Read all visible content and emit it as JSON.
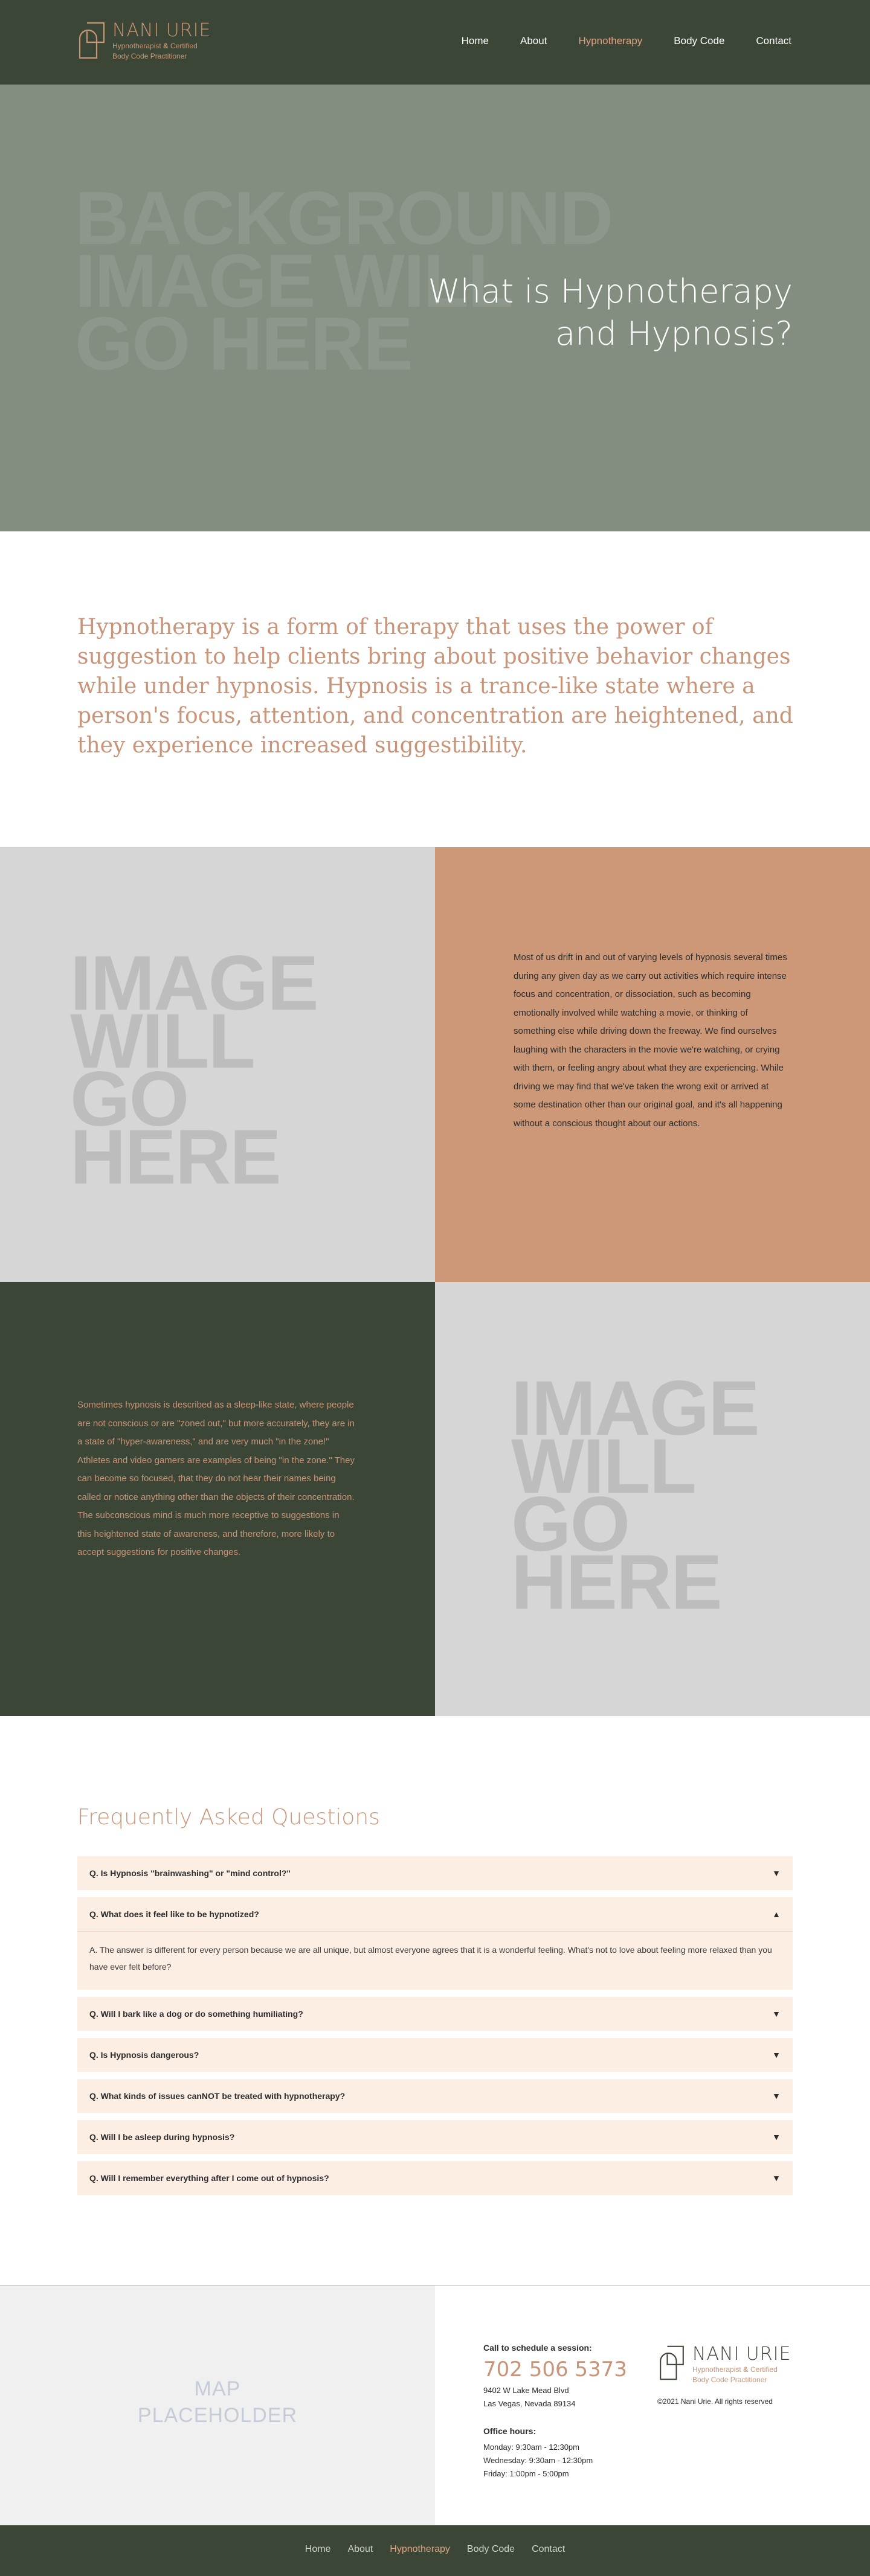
{
  "brand": {
    "name": "NANI URIE",
    "subtitle_line1_pre": "Hypnotherapist ",
    "subtitle_amp": "&",
    "subtitle_line1_post": " Certified",
    "subtitle_line2": "Body Code Practitioner"
  },
  "nav": {
    "items": [
      {
        "label": "Home",
        "active": false
      },
      {
        "label": "About",
        "active": false
      },
      {
        "label": "Hypnotherapy",
        "active": true
      },
      {
        "label": "Body Code",
        "active": false
      },
      {
        "label": "Contact",
        "active": false
      }
    ]
  },
  "hero": {
    "placeholder_lines": [
      "BACKGROUND",
      "IMAGE WILL",
      "GO HERE"
    ],
    "title_line1": "What is Hypnotherapy",
    "title_line2": "and Hypnosis?"
  },
  "intro": {
    "text": "Hypnotherapy is a form of therapy that uses the power of suggestion to help clients bring about positive behavior changes while under hypnosis. Hypnosis is a trance-like state where a person's focus, attention, and concentration are heightened, and they experience increased suggestibility."
  },
  "section1": {
    "placeholder_lines": [
      "IMAGE",
      "WILL",
      "GO",
      "HERE"
    ],
    "text": "Most of us drift in and out of varying levels of hypnosis several times during any given day as we carry out activities which require intense focus and concentration, or dissociation, such as becoming emotionally involved while watching a movie, or thinking of something else while driving down the freeway. We find ourselves laughing with the characters in the movie we're watching, or crying with them, or feeling angry about what they are experiencing. While driving we may find that we've taken the wrong exit or arrived at some destination other than our original goal, and it's all happening without a conscious thought about our actions."
  },
  "section2": {
    "placeholder_lines": [
      "IMAGE",
      "WILL",
      "GO",
      "HERE"
    ],
    "text": "Sometimes hypnosis is described as a sleep-like state, where people are not conscious or are \"zoned out,\" but more accurately, they are in a state of \"hyper-awareness,\" and are very much \"in the zone!\"  Athletes and video gamers are examples of being \"in the zone.\" They can become so focused, that they do not hear their names being called or notice anything other than the objects of their concentration. The subconscious mind is much more receptive to suggestions in this heightened state of awareness, and therefore, more likely to accept suggestions for positive changes."
  },
  "faq": {
    "title": "Frequently Asked Questions",
    "items": [
      {
        "q": "Q. Is Hypnosis \"brainwashing\" or \"mind control?\"",
        "open": false,
        "arrow": "▼",
        "a": ""
      },
      {
        "q": "Q. What does it feel like to be hypnotized?",
        "open": true,
        "arrow": "▲",
        "a": "A. The answer is different for every person because we are all unique, but almost everyone agrees that it is a wonderful feeling. What's not to love about feeling more relaxed than you have ever felt before?"
      },
      {
        "q": "Q.  Will I bark like a dog or do something humiliating?",
        "open": false,
        "arrow": "▼",
        "a": ""
      },
      {
        "q": "Q. Is Hypnosis dangerous?",
        "open": false,
        "arrow": "▼",
        "a": ""
      },
      {
        "q": "Q. What kinds of issues canNOT be treated with hypnotherapy?",
        "open": false,
        "arrow": "▼",
        "a": ""
      },
      {
        "q": "Q. Will I be asleep during hypnosis?",
        "open": false,
        "arrow": "▼",
        "a": ""
      },
      {
        "q": "Q. Will I remember everything after I come out of hypnosis?",
        "open": false,
        "arrow": "▼",
        "a": ""
      }
    ]
  },
  "contact": {
    "map_line1": "MAP",
    "map_line2": "PLACEHOLDER",
    "schedule_label": "Call to schedule a session:",
    "phone": "702 506 5373",
    "address_line1": "9402 W Lake Mead Blvd",
    "address_line2": "Las Vegas, Nevada 89134",
    "hours_label": "Office hours:",
    "hours": [
      "Monday: 9:30am - 12:30pm",
      "Wednesday: 9:30am - 12:30pm",
      "Friday: 1:00pm - 5:00pm"
    ],
    "copyright": "©2021 Nani Urie. All rights reserved"
  },
  "footer": {
    "items": [
      {
        "label": "Home",
        "active": false
      },
      {
        "label": "About",
        "active": false
      },
      {
        "label": "Hypnotherapy",
        "active": true
      },
      {
        "label": "Body Code",
        "active": false
      },
      {
        "label": "Contact",
        "active": false
      }
    ]
  },
  "colors": {
    "dark_green": "#3b4636",
    "accent": "#c8957a",
    "terracotta": "#cc9878",
    "hero_gray": "#838e80",
    "faq_bg": "#fdeee4"
  }
}
